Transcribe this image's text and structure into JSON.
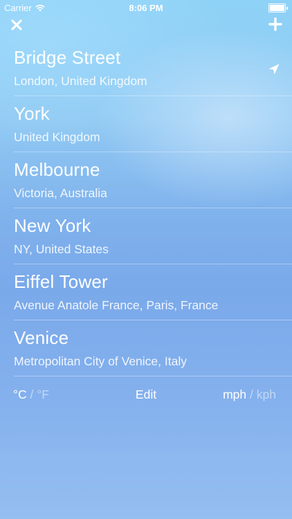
{
  "status_bar": {
    "carrier": "Carrier",
    "time": "8:06 PM",
    "battery_level": 1.0
  },
  "header": {
    "close_icon": "close-icon",
    "add_icon": "plus-icon"
  },
  "locations": [
    {
      "name": "Bridge Street",
      "subtitle": "London, United Kingdom",
      "current_location": true
    },
    {
      "name": "York",
      "subtitle": "United Kingdom"
    },
    {
      "name": "Melbourne",
      "subtitle": "Victoria, Australia"
    },
    {
      "name": "New York",
      "subtitle": "NY, United States"
    },
    {
      "name": "Eiffel Tower",
      "subtitle": "Avenue Anatole France, Paris, France"
    },
    {
      "name": "Venice",
      "subtitle": "Metropolitan City of Venice, Italy"
    }
  ],
  "footer": {
    "temp_celsius": "°C",
    "temp_fahrenheit": "°F",
    "separator": "/",
    "edit_label": "Edit",
    "speed_mph": "mph",
    "speed_kph": "kph"
  },
  "colors": {
    "background_top": "#8fd2f7",
    "background_mid": "#7aa9ea",
    "text": "#ffffff"
  }
}
